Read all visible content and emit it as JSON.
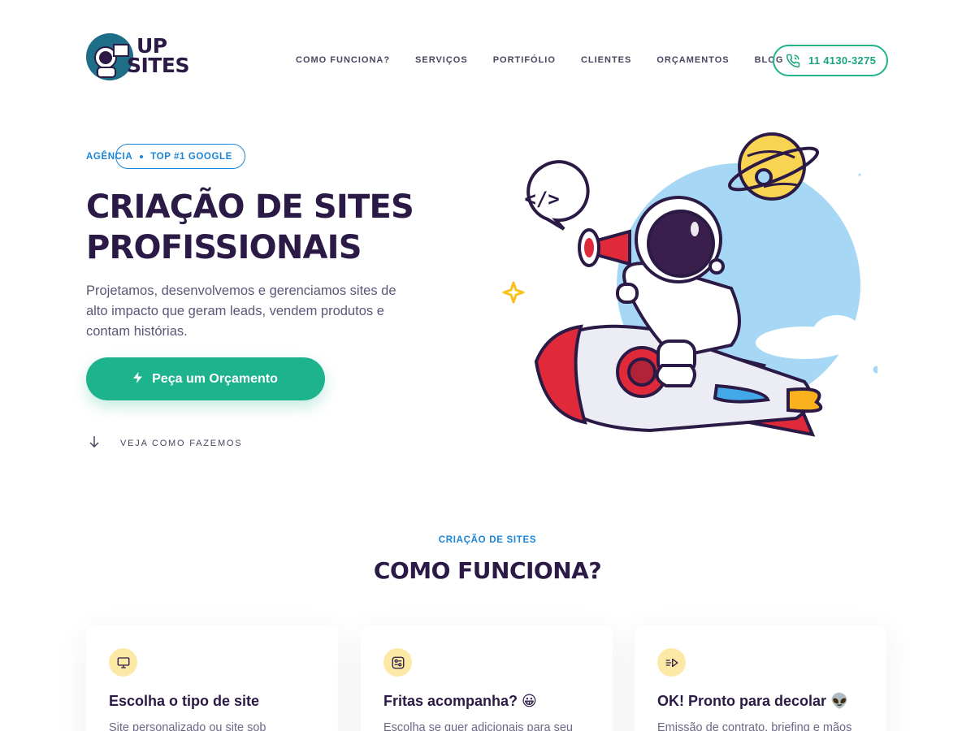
{
  "brand": {
    "logo_line1": "UP",
    "logo_line2": "SITES"
  },
  "nav": {
    "items": [
      {
        "label": "COMO FUNCIONA?"
      },
      {
        "label": "SERVIÇOS"
      },
      {
        "label": "PORTIFÓLIO"
      },
      {
        "label": "CLIENTES"
      },
      {
        "label": "ORÇAMENTOS"
      },
      {
        "label": "BLOG"
      }
    ],
    "phone": "11 4130-3275"
  },
  "hero": {
    "badge_left": "AGÊNCIA",
    "badge_right": "TOP #1 GOOGLE",
    "title_line1": "CRIAÇÃO DE SITES",
    "title_line2": "PROFISSIONAIS",
    "description": "Projetamos, desenvolvemos e gerenciamos sites de alto impacto que geram leads, vendem produtos e contam histórias.",
    "cta_label": "Peça um Orçamento",
    "scroll_label": "VEJA COMO FAZEMOS",
    "speech_bubble_code": "</>"
  },
  "section": {
    "label": "CRIAÇÃO DE SITES",
    "title": "COMO FUNCIONA?",
    "cards": [
      {
        "icon": "monitor-icon",
        "title": "Escolha o tipo de site",
        "text": "Site personalizado ou site sob"
      },
      {
        "icon": "options-icon",
        "title": "Fritas acompanha? 😀",
        "text": "Escolha se quer adicionais para seu"
      },
      {
        "icon": "launch-icon",
        "title": "OK! Pronto para decolar 👽",
        "text": "Emissão de contrato, briefing e mãos"
      }
    ]
  },
  "colors": {
    "primary_dark": "#2b1a45",
    "accent_green": "#1cb38d",
    "accent_blue": "#1a86d9",
    "icon_bg": "#fde9a6"
  }
}
